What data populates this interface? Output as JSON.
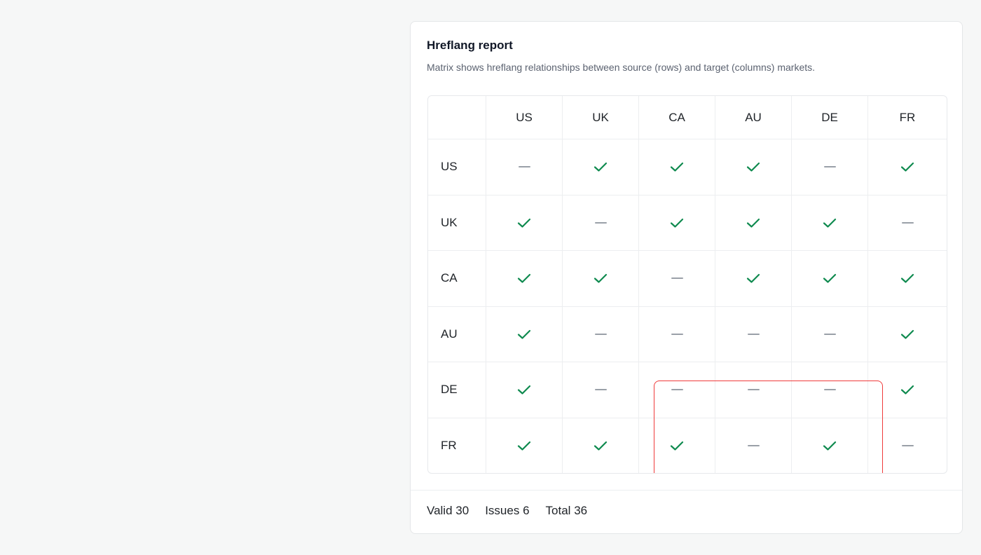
{
  "report": {
    "title": "Hreflang report",
    "subtitle": "Matrix shows hreflang relationships between source (rows) and target (columns) markets."
  },
  "matrix": {
    "columns": [
      "US",
      "UK",
      "CA",
      "AU",
      "DE",
      "FR"
    ],
    "rows": [
      {
        "label": "US",
        "cells": [
          "none",
          "valid",
          "valid",
          "valid",
          "none",
          "valid"
        ]
      },
      {
        "label": "UK",
        "cells": [
          "valid",
          "none",
          "valid",
          "valid",
          "valid",
          "none"
        ]
      },
      {
        "label": "CA",
        "cells": [
          "valid",
          "valid",
          "none",
          "valid",
          "valid",
          "valid"
        ]
      },
      {
        "label": "AU",
        "cells": [
          "valid",
          "none",
          "none",
          "none",
          "none",
          "valid"
        ]
      },
      {
        "label": "DE",
        "cells": [
          "valid",
          "none",
          "none",
          "none",
          "none",
          "valid"
        ]
      },
      {
        "label": "FR",
        "cells": [
          "valid",
          "valid",
          "valid",
          "none",
          "valid",
          "none"
        ]
      }
    ],
    "icons": {
      "valid": "check-icon",
      "none": "dash-icon"
    },
    "colors": {
      "check": "#0f8a4f",
      "dash": "#9aa0a8",
      "highlight": "#ef3b3b"
    }
  },
  "summary": {
    "valid_label": "Valid",
    "valid_count": "30",
    "issues_label": "Issues",
    "issues_count": "6",
    "total_label": "Total",
    "total_count": "36"
  }
}
